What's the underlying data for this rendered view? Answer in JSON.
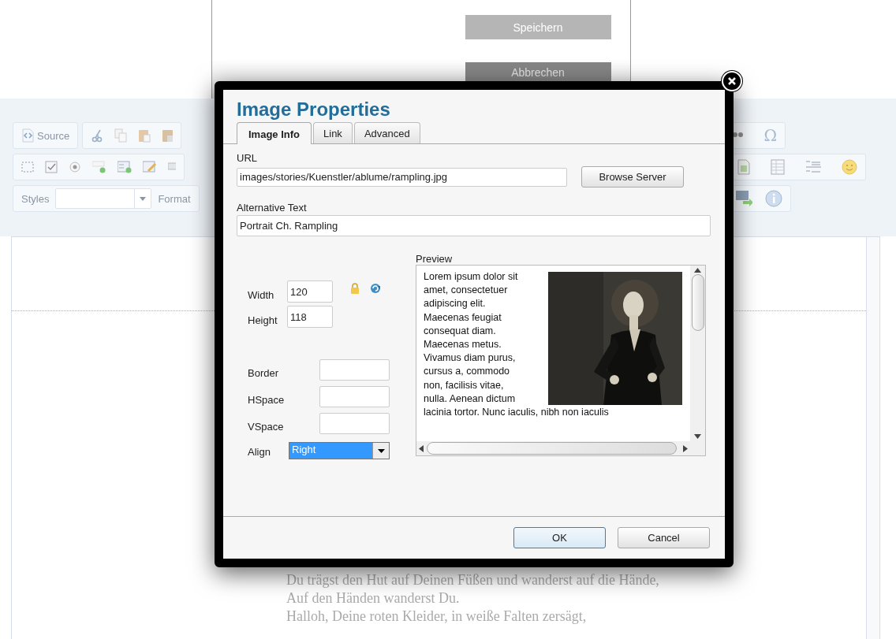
{
  "page_buttons": [
    {
      "label": "Speichern",
      "kind": "normal"
    },
    {
      "label": "Abbrechen",
      "kind": "shaded"
    }
  ],
  "toolbar": {
    "source_label": "Source",
    "special_char": "Ω",
    "styles_label": "Styles",
    "format_label": "Format"
  },
  "editor_lines": [
    "Du trägst den Hut auf Deinen Füßen und wanderst auf die Hände,",
    "Auf den Händen wanderst Du.",
    "Halloh, Deine roten Kleider, in weiße Falten zersägt,"
  ],
  "dialog": {
    "title": "Image Properties",
    "tabs": [
      {
        "label": "Image Info",
        "selected": true
      },
      {
        "label": "Link",
        "selected": false
      },
      {
        "label": "Advanced",
        "selected": false
      }
    ],
    "url": {
      "label": "URL",
      "value": "images/stories/Kuenstler/ablume/rampling.jpg"
    },
    "browse_button": "Browse Server",
    "alt": {
      "label": "Alternative Text",
      "value": "Portrait Ch. Rampling"
    },
    "size_fields": [
      {
        "label": "Width",
        "value": "120"
      },
      {
        "label": "Height",
        "value": "118"
      }
    ],
    "spacing_fields": [
      {
        "label": "Border"
      },
      {
        "label": "HSpace"
      },
      {
        "label": "VSpace"
      }
    ],
    "align": {
      "label": "Align",
      "value": "Right",
      "focused": true
    },
    "preview": {
      "label": "Preview",
      "lines": [
        "Lorem ipsum dolor sit",
        "amet, consectetuer",
        "adipiscing elit.",
        "Maecenas feugiat",
        "consequat diam.",
        "Maecenas metus.",
        "Vivamus diam purus,",
        "cursus a, commodo",
        "non, facilisis vitae,",
        "nulla. Aenean dictum",
        "lacinia tortor. Nunc iaculis, nibh non iaculis"
      ]
    },
    "buttons": [
      {
        "label": "OK",
        "focused": true
      },
      {
        "label": "Cancel",
        "focused": false
      }
    ]
  }
}
